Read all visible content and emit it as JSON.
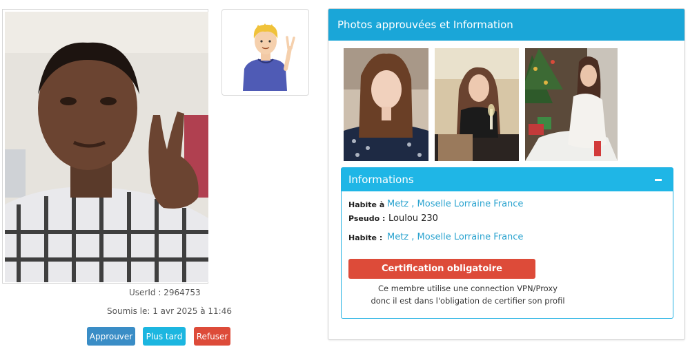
{
  "candidate": {
    "user_id_text": "UserId : 2964753",
    "submitted_text": "Soumis le: 1 avr 2025 à 11:46"
  },
  "actions": {
    "approve_label": "Approuver",
    "later_label": "Plus tard",
    "refuse_label": "Refuser"
  },
  "panel": {
    "title": "Photos approuvées et Information"
  },
  "info": {
    "title": "Informations",
    "rows": [
      {
        "label": "Habite à",
        "value": "Metz , Moselle  Lorraine France"
      },
      {
        "label": "Pseudo :",
        "value": "Loulou 230"
      },
      {
        "label": "Habite :",
        "value": "Metz , Moselle  Lorraine France"
      }
    ],
    "cert_button": "Certification obligatoire",
    "cert_note_line1": "Ce membre utilise une connection VPN/Proxy",
    "cert_note_line2": "donc il est dans l'obligation de certifier son profil"
  },
  "colors": {
    "primary": "#1aa6d8",
    "danger": "#dd4b39",
    "approve": "#3a8dc6",
    "later": "#1cb6e0",
    "link": "#2aa3cf"
  }
}
